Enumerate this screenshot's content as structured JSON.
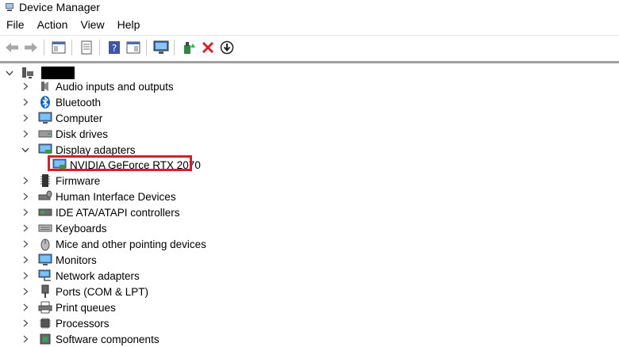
{
  "window": {
    "title": "Device Manager"
  },
  "menu": [
    "File",
    "Action",
    "View",
    "Help"
  ],
  "toolbar": [
    "back-arrow-icon",
    "forward-arrow-icon",
    "properties-pane-icon",
    "page-icon",
    "help-icon",
    "show-hide-pane-icon",
    "monitor-scan-icon",
    "update-driver-icon",
    "uninstall-x-icon",
    "disable-device-icon"
  ],
  "tree": {
    "root": {
      "name_redacted": true
    },
    "categories": [
      {
        "label": "Audio inputs and outputs",
        "icon": "speaker-icon",
        "expanded": false
      },
      {
        "label": "Bluetooth",
        "icon": "bluetooth-icon",
        "expanded": false
      },
      {
        "label": "Computer",
        "icon": "computer-icon",
        "expanded": false
      },
      {
        "label": "Disk drives",
        "icon": "disk-drive-icon",
        "expanded": false
      },
      {
        "label": "Display adapters",
        "icon": "display-adapter-icon",
        "expanded": true,
        "children": [
          {
            "label": "NVIDIA GeForce RTX 2070",
            "icon": "display-adapter-icon",
            "highlighted": true
          }
        ]
      },
      {
        "label": "Firmware",
        "icon": "firmware-chip-icon",
        "expanded": false
      },
      {
        "label": "Human Interface Devices",
        "icon": "hid-icon",
        "expanded": false
      },
      {
        "label": "IDE ATA/ATAPI controllers",
        "icon": "ide-controller-icon",
        "expanded": false
      },
      {
        "label": "Keyboards",
        "icon": "keyboard-icon",
        "expanded": false
      },
      {
        "label": "Mice and other pointing devices",
        "icon": "mouse-icon",
        "expanded": false
      },
      {
        "label": "Monitors",
        "icon": "monitor-icon",
        "expanded": false
      },
      {
        "label": "Network adapters",
        "icon": "network-adapter-icon",
        "expanded": false
      },
      {
        "label": "Ports (COM & LPT)",
        "icon": "port-icon",
        "expanded": false
      },
      {
        "label": "Print queues",
        "icon": "printer-icon",
        "expanded": false
      },
      {
        "label": "Processors",
        "icon": "processor-icon",
        "expanded": false
      },
      {
        "label": "Software components",
        "icon": "software-component-icon",
        "expanded": false
      }
    ]
  },
  "colors": {
    "highlight_border": "#d5202b",
    "selection": "#cce8ff"
  }
}
